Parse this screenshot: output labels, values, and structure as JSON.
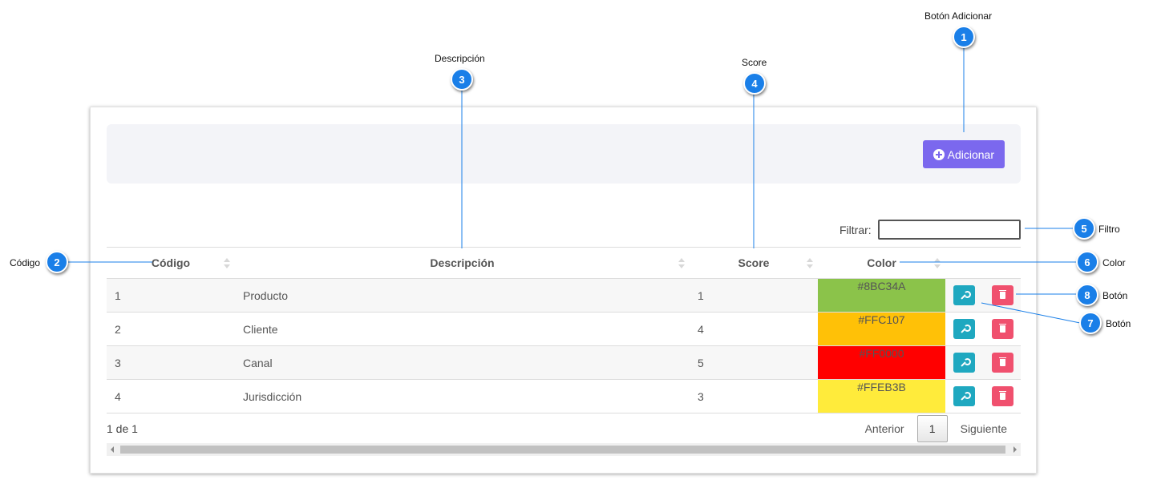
{
  "toolbar": {
    "add_label": "Adicionar"
  },
  "filter": {
    "label": "Filtrar:",
    "value": ""
  },
  "table": {
    "columns": [
      "Código",
      "Descripción",
      "Score",
      "Color"
    ],
    "rows": [
      {
        "codigo": "1",
        "descripcion": "Producto",
        "score": "1",
        "color": "#8BC34A"
      },
      {
        "codigo": "2",
        "descripcion": "Cliente",
        "score": "4",
        "color": "#FFC107"
      },
      {
        "codigo": "3",
        "descripcion": "Canal",
        "score": "5",
        "color": "#FF0000"
      },
      {
        "codigo": "4",
        "descripcion": "Jurisdicción",
        "score": "3",
        "color": "#FFEB3B"
      }
    ]
  },
  "pagination": {
    "info": "1 de 1",
    "prev": "Anterior",
    "page": "1",
    "next": "Siguiente"
  },
  "callouts": [
    {
      "num": "1",
      "label": "Botón  Adicionar"
    },
    {
      "num": "2",
      "label": "Código"
    },
    {
      "num": "3",
      "label": "Descripción"
    },
    {
      "num": "4",
      "label": "Score"
    },
    {
      "num": "5",
      "label": "Filtro"
    },
    {
      "num": "6",
      "label": "Color"
    },
    {
      "num": "7",
      "label": "Botón"
    },
    {
      "num": "8",
      "label": "Botón"
    }
  ],
  "colors": {
    "accent_button": "#7b68ee",
    "edit_button": "#1fa8c0",
    "delete_button": "#f0506e",
    "badge": "#1a7fe8"
  },
  "icons": {
    "add": "plus-circle-icon",
    "edit": "wrench-icon",
    "delete": "trash-icon"
  }
}
